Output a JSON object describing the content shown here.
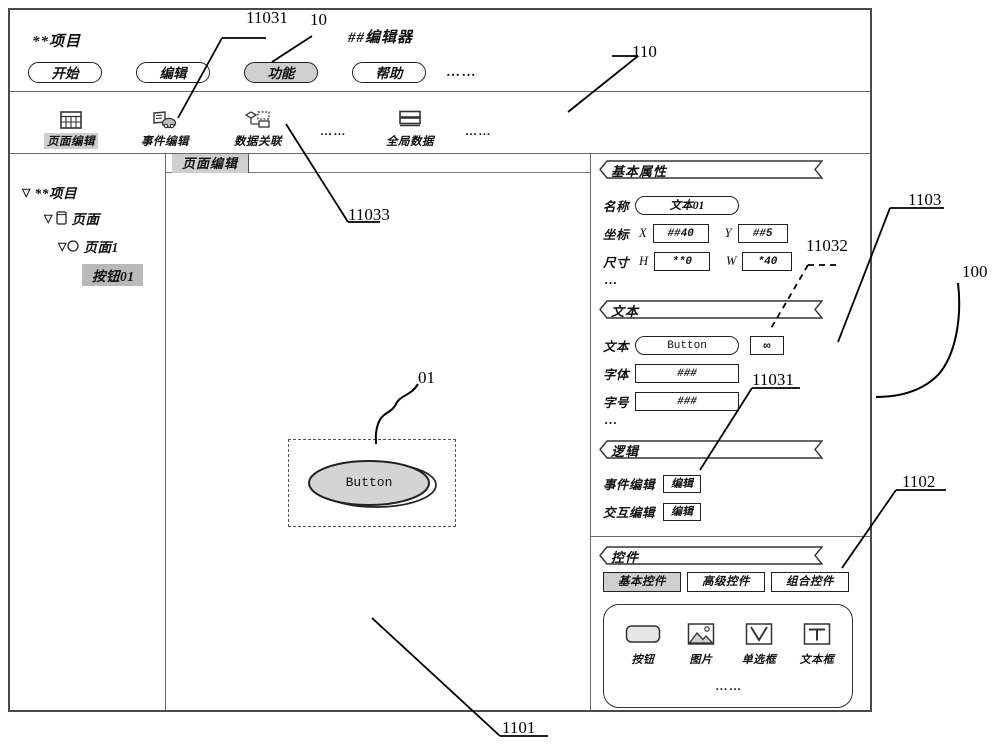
{
  "window": {
    "project_title": "**项目",
    "app_title": "##编辑器"
  },
  "menubar": {
    "items": [
      {
        "label": "开始",
        "selected": false
      },
      {
        "label": "编辑",
        "selected": false
      },
      {
        "label": "功能",
        "selected": true
      },
      {
        "label": "帮助",
        "selected": false
      }
    ],
    "overflow": "……"
  },
  "ribbon": {
    "tools": [
      {
        "label": "页面编辑",
        "icon": "page-edit-icon",
        "selected": true
      },
      {
        "label": "事件编辑",
        "icon": "event-edit-icon",
        "selected": false
      },
      {
        "label": "数据关联",
        "icon": "data-link-icon",
        "selected": false
      },
      {
        "label": "全局数据",
        "icon": "global-data-icon",
        "selected": false
      }
    ],
    "overflow_1": "……",
    "overflow_2": "……"
  },
  "tree": {
    "nodes": [
      {
        "label": "**项目",
        "triangle": "▽",
        "icon": "",
        "selected": false
      },
      {
        "label": "页面",
        "triangle": "▽",
        "icon": "page-icon",
        "selected": false
      },
      {
        "label": "页面1",
        "triangle": "▽",
        "icon": "circle-icon",
        "selected": false
      },
      {
        "label": "按钮01",
        "triangle": "",
        "icon": "",
        "selected": true
      }
    ]
  },
  "canvas": {
    "tab_label": "页面编辑",
    "widget_text": "Button"
  },
  "properties": {
    "basic": {
      "header": "基本属性",
      "name_label": "名称",
      "name_value": "文本01",
      "coord_label": "坐标",
      "x_label": "X",
      "x_value": "##40",
      "y_label": "Y",
      "y_value": "##5",
      "size_label": "尺寸",
      "h_label": "H",
      "h_value": "**0",
      "w_label": "W",
      "w_value": "*40",
      "more": "…"
    },
    "text": {
      "header": "文本",
      "text_label": "文本",
      "text_value": "Button",
      "link_value": "∞",
      "font_label": "字体",
      "font_value": "###",
      "size_label": "字号",
      "size_value": "###",
      "more": "…"
    },
    "logic": {
      "header": "逻辑",
      "event_label": "事件编辑",
      "event_button": "编辑",
      "interaction_label": "交互编辑",
      "interaction_button": "编辑"
    },
    "widgets": {
      "header": "控件",
      "categories": [
        {
          "label": "基本控件",
          "selected": true
        },
        {
          "label": "高级控件",
          "selected": false
        },
        {
          "label": "组合控件",
          "selected": false
        }
      ],
      "items": [
        {
          "label": "按钮",
          "icon": "button-shape-icon"
        },
        {
          "label": "图片",
          "icon": "image-icon"
        },
        {
          "label": "单选框",
          "icon": "checkmark-icon"
        },
        {
          "label": "文本框",
          "icon": "textbox-icon"
        }
      ],
      "overflow": "……"
    }
  },
  "callouts": [
    {
      "id": "ref-11031-top",
      "text": "11031"
    },
    {
      "id": "ref-10",
      "text": "10"
    },
    {
      "id": "ref-110",
      "text": "110"
    },
    {
      "id": "ref-11033",
      "text": "11033"
    },
    {
      "id": "ref-01",
      "text": "01"
    },
    {
      "id": "ref-11032",
      "text": "11032"
    },
    {
      "id": "ref-1103",
      "text": "1103"
    },
    {
      "id": "ref-100",
      "text": "100"
    },
    {
      "id": "ref-11031-right",
      "text": "11031"
    },
    {
      "id": "ref-1102",
      "text": "1102"
    },
    {
      "id": "ref-1101",
      "text": "1101"
    }
  ],
  "colors": {
    "selection_gray": "#cfcfcf",
    "tree_select_gray": "#b9b9b9",
    "frame_stroke": "#4a4a4a",
    "widget_fill": "#d4d4d4"
  }
}
